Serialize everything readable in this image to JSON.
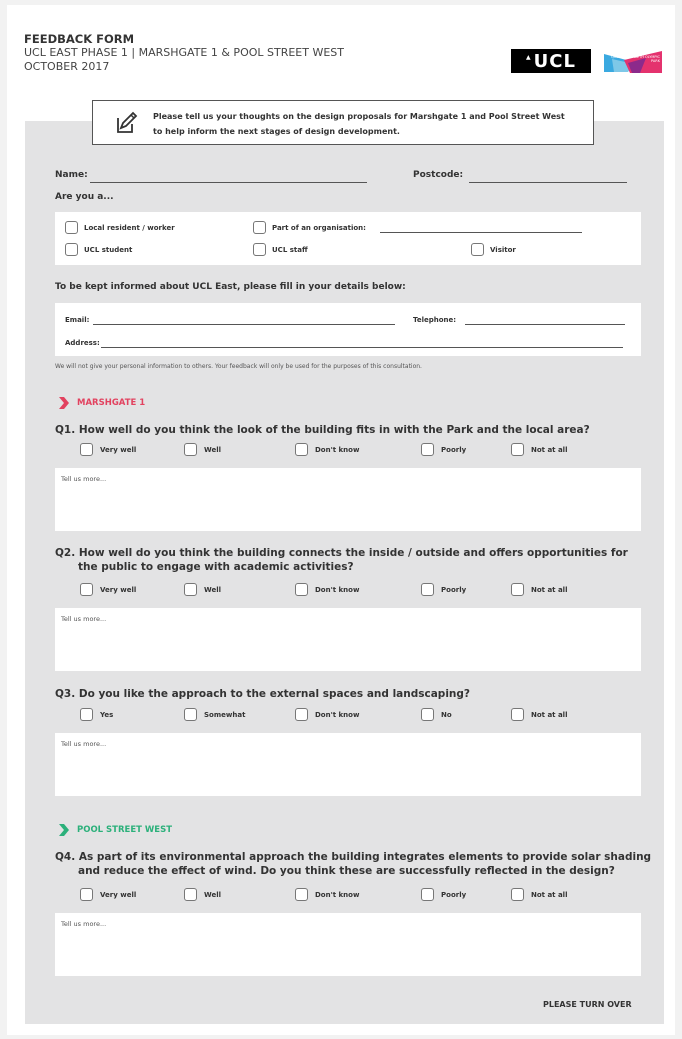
{
  "header": {
    "title": "FEEDBACK FORM",
    "line1": "UCL EAST PHASE 1 | MARSHGATE 1 & POOL STREET WEST",
    "line2": "OCTOBER 2017",
    "ucl_logo": "UCL",
    "park_logo": "QUEEN ELIZABETH OLYMPIC PARK"
  },
  "intro": {
    "icon": "edit-icon",
    "line1": "Please tell us your thoughts on the design proposals for Marshgate 1 and Pool Street West",
    "line2": "to help inform the next stages of design development."
  },
  "personal": {
    "name_label": "Name:",
    "postcode_label": "Postcode:",
    "are_you_label": "Are you a...",
    "options": {
      "local": "Local resident / worker",
      "organisation": "Part of an organisation:",
      "student": "UCL student",
      "staff": "UCL staff",
      "visitor": "Visitor"
    }
  },
  "contact": {
    "heading": "To be kept informed about UCL East, please fill in your details below:",
    "email_label": "Email:",
    "telephone_label": "Telephone:",
    "address_label": "Address:",
    "privacy": "We will not give your personal information to others. Your feedback will only be used for the purposes of this consultation."
  },
  "sections": {
    "marshgate": {
      "title": "MARSHGATE 1",
      "color": "#e2425f"
    },
    "pool_street": {
      "title": "POOL STREET WEST",
      "color": "#2bb07a"
    }
  },
  "questions": {
    "q1": {
      "text": "Q1. How well do you think the look of the building fits in with the Park and the local area?",
      "options": [
        "Very well",
        "Well",
        "Don't know",
        "Poorly",
        "Not at all"
      ],
      "placeholder": "Tell us more..."
    },
    "q2": {
      "line1": "Q2. How well do you think the building connects the inside / outside and offers opportunities for",
      "line2": "the public to engage with academic activities?",
      "options": [
        "Very well",
        "Well",
        "Don't know",
        "Poorly",
        "Not at all"
      ],
      "placeholder": "Tell us more..."
    },
    "q3": {
      "text": "Q3. Do you like the approach to the external spaces and landscaping?",
      "options": [
        "Yes",
        "Somewhat",
        "Don't know",
        "No",
        "Not at all"
      ],
      "placeholder": "Tell us more..."
    },
    "q4": {
      "line1": "Q4. As part of its environmental approach the building integrates elements to provide solar shading",
      "line2": "and reduce the effect of wind. Do you think these are successfully reflected in the design?",
      "options": [
        "Very well",
        "Well",
        "Don't know",
        "Poorly",
        "Not at all"
      ],
      "placeholder": "Tell us more..."
    }
  },
  "footer": {
    "turn_over": "PLEASE TURN OVER"
  }
}
